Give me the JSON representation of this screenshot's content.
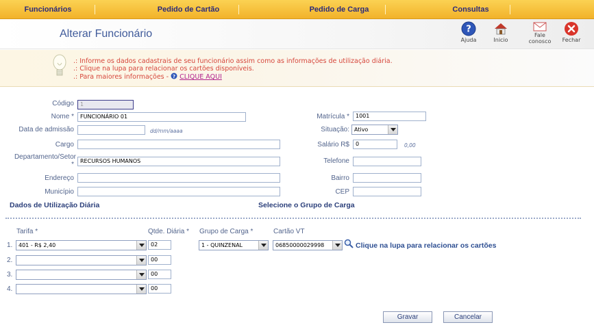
{
  "nav": {
    "items": [
      {
        "label": "Funcionários"
      },
      {
        "label": "Pedido de Cartão"
      },
      {
        "label": "Pedido de Carga"
      },
      {
        "label": "Consultas"
      }
    ]
  },
  "header": {
    "title": "Alterar Funcionário",
    "tools": {
      "help": "Ajuda",
      "home": "Inicio",
      "contact_line1": "Fale",
      "contact_line2": "conosco",
      "close": "Fechar"
    }
  },
  "info": {
    "line1": ".: Informe os dados cadastrais de seu funcionário assim como as informações de utilização diária.",
    "line2": ".: Clique na lupa para relacionar os cartões disponíveis.",
    "line3_prefix": ".: Para maiores informações -",
    "line3_link": "CLIQUE AQUI"
  },
  "form": {
    "codigo": {
      "label": "Código",
      "value": "1"
    },
    "nome": {
      "label": "Nome *",
      "value": "FUNCIONÁRIO 01"
    },
    "data_admissao": {
      "label": "Data de admissão",
      "value": "",
      "hint": "dd/mm/aaaa"
    },
    "cargo": {
      "label": "Cargo",
      "value": ""
    },
    "departamento": {
      "label_line1": "Departamento/Setor",
      "label_line2": "*",
      "value": "RECURSOS HUMANOS"
    },
    "endereco": {
      "label": "Endereço",
      "value": ""
    },
    "municipio": {
      "label": "Município",
      "value": ""
    },
    "matricula": {
      "label": "Matrícula *",
      "value": "1001"
    },
    "situacao": {
      "label": "Situação:",
      "value": "Ativo"
    },
    "salario": {
      "label": "Salário R$",
      "value": "0",
      "display": "0,00"
    },
    "telefone": {
      "label": "Telefone",
      "value": ""
    },
    "bairro": {
      "label": "Bairro",
      "value": ""
    },
    "cep": {
      "label": "CEP",
      "value": ""
    }
  },
  "sections": {
    "utilizacao": "Dados de Utilização Diária",
    "grupo_carga": "Selecione o Grupo de Carga"
  },
  "usage": {
    "headers": {
      "tarifa": "Tarifa *",
      "qtde": "Qtde. Diária *",
      "grupo": "Grupo de Carga *",
      "cartao": "Cartão VT"
    },
    "rows": [
      {
        "num": "1.",
        "tarifa": "401 - R$ 2,40",
        "qtde": "02"
      },
      {
        "num": "2.",
        "tarifa": "",
        "qtde": "00"
      },
      {
        "num": "3.",
        "tarifa": "",
        "qtde": "00"
      },
      {
        "num": "4.",
        "tarifa": "",
        "qtde": "00"
      }
    ],
    "grupo_value": "1 - QUINZENAL",
    "cartao_value": "06850000029998",
    "lupa_text": "Clique na lupa para relacionar os cartões"
  },
  "buttons": {
    "save": "Gravar",
    "cancel": "Cancelar"
  },
  "colors": {
    "nav_bg": "#f2b22a",
    "title": "#3f5a9a",
    "info_text": "#d6463b",
    "label": "#52648c"
  }
}
